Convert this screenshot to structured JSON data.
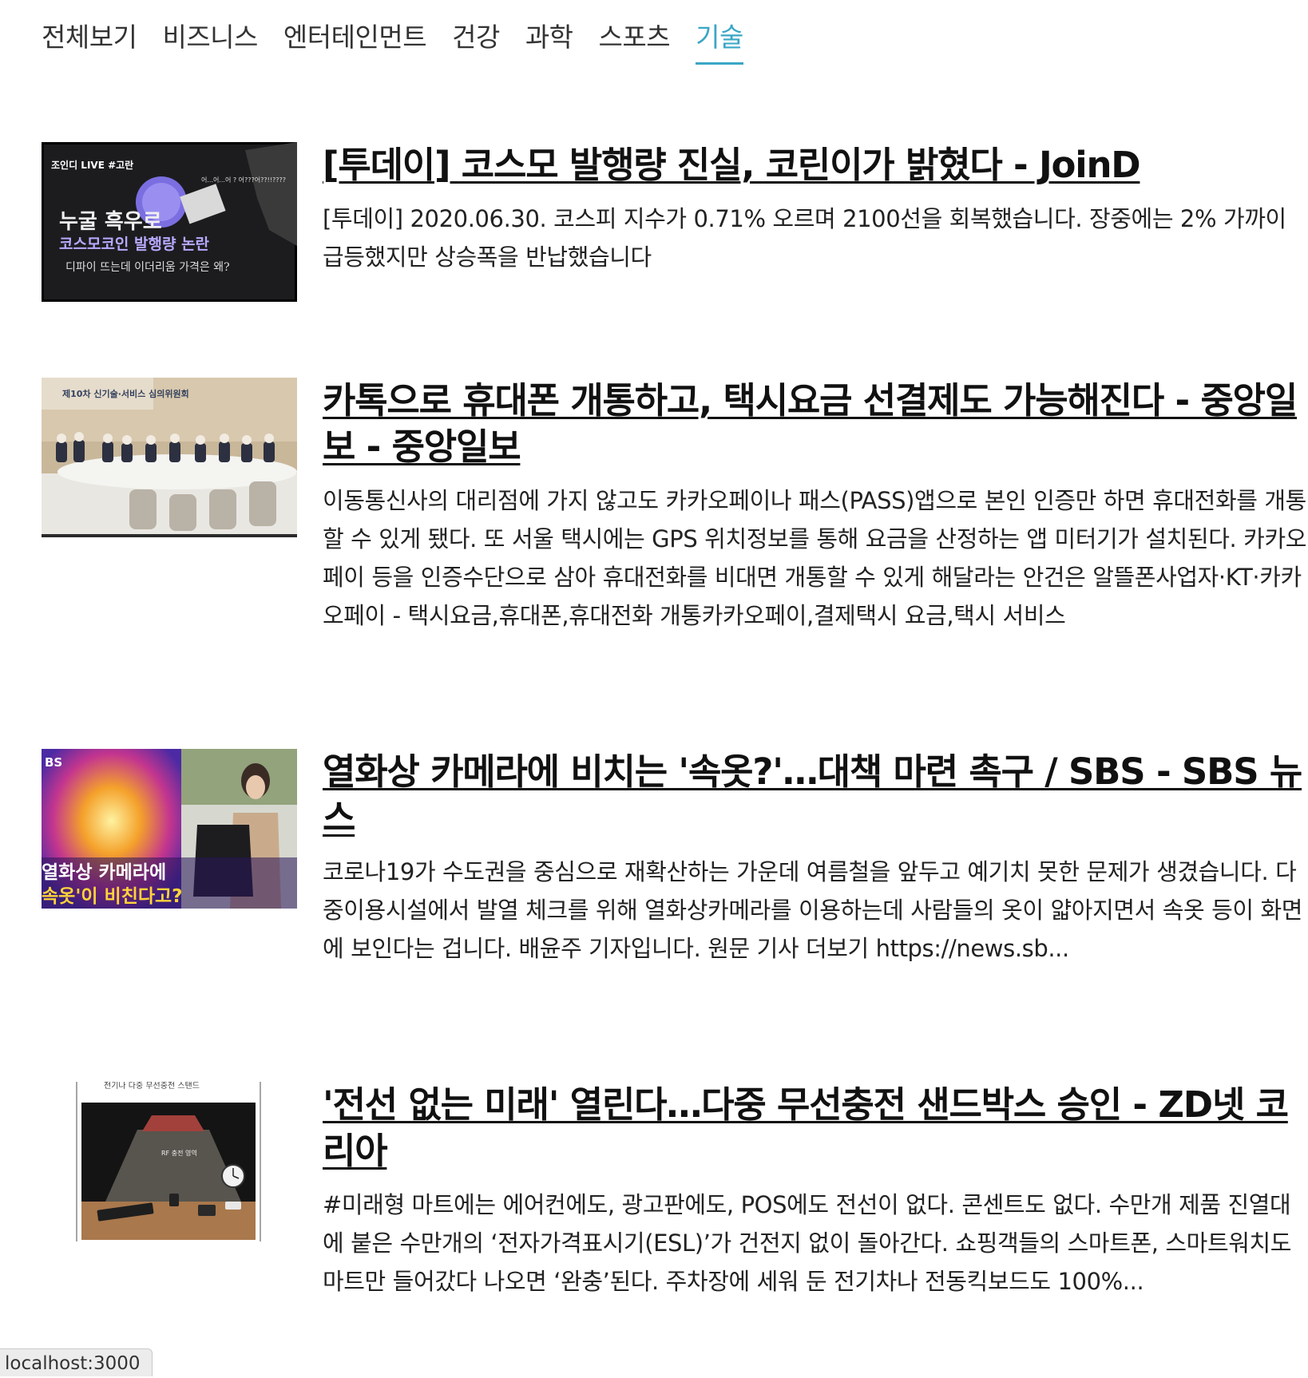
{
  "nav": {
    "items": [
      {
        "label": "전체보기"
      },
      {
        "label": "비즈니스"
      },
      {
        "label": "엔터테인먼트"
      },
      {
        "label": "건강"
      },
      {
        "label": "과학"
      },
      {
        "label": "스포츠"
      },
      {
        "label": "기술"
      }
    ],
    "active_index": 6,
    "accent_color": "#3aa6c6"
  },
  "articles": [
    {
      "title": "[투데이] 코스모 발행량 진실, 코린이가 밝혔다 - JoinD",
      "description": "[투데이] 2020.06.30. 코스피 지수가 0.71% 오르며 2100선을 회복했습니다. 장중에는 2% 가까이 급등했지만 상승폭을 반납했습니다",
      "thumbnail": {
        "tag": "조인디 LIVE #고란",
        "bubble": "어...어...어 ? 어???어??!!????",
        "line1": "누굴 흑우로",
        "line2": "코스모코인 발행량 논란",
        "line3": "디파이 뜨는데 이더리움 가격은 왜?"
      }
    },
    {
      "title": "카톡으로 휴대폰 개통하고, 택시요금 선결제도 가능해진다 - 중앙일보 - 중앙일보",
      "description": "이동통신사의 대리점에 가지 않고도 카카오페이나 패스(PASS)앱으로 본인 인증만 하면 휴대전화를 개통할 수 있게 됐다. 또 서울 택시에는 GPS 위치정보를 통해 요금을 산정하는 앱 미터기가 설치된다. 카카오페이 등을 인증수단으로 삼아 휴대전화를 비대면 개통할 수 있게 해달라는 안건은 알뜰폰사업자·KT·카카오페이 - 택시요금,휴대폰,휴대전화 개통카카오페이,결제택시 요금,택시 서비스",
      "thumbnail": {
        "banner": "제10차 신기술·서비스 심의위원회"
      }
    },
    {
      "title": "열화상 카메라에 비치는 '속옷?'…대책 마련 촉구 / SBS - SBS 뉴스",
      "description": "코로나19가 수도권을 중심으로 재확산하는 가운데 여름철을 앞두고 예기치 못한 문제가 생겼습니다. 다중이용시설에서 발열 체크를 위해 열화상카메라를 이용하는데 사람들의 옷이 얇아지면서 속옷 등이 화면에 보인다는 겁니다. 배윤주 기자입니다. 원문 기사 더보기 https://news.sb...",
      "thumbnail": {
        "logo": "BS",
        "caption1": "열화상 카메라에",
        "caption2": "속옷'이 비친다고?"
      }
    },
    {
      "title": "'전선 없는 미래' 열린다…다중 무선충전 샌드박스 승인 - ZD넷 코리아",
      "description": "#미래형 마트에는 에어컨에도, 광고판에도, POS에도 전선이 없다. 콘센트도 없다. 수만개 제품 진열대에 붙은 수만개의 ‘전자가격표시기(ESL)’가 건전지 없이 돌아간다. 쇼핑객들의 스마트폰, 스마트워치도 마트만 들어갔다 나오면 ‘완충’된다. 주차장에 세워 둔 전기차나 전동킥보드도 100%...",
      "thumbnail": {
        "top_caption": "전기나 다중 무선충전 스탠드",
        "label": "RF 충전 영역"
      }
    }
  ],
  "status_bar": {
    "url": "localhost:3000"
  }
}
